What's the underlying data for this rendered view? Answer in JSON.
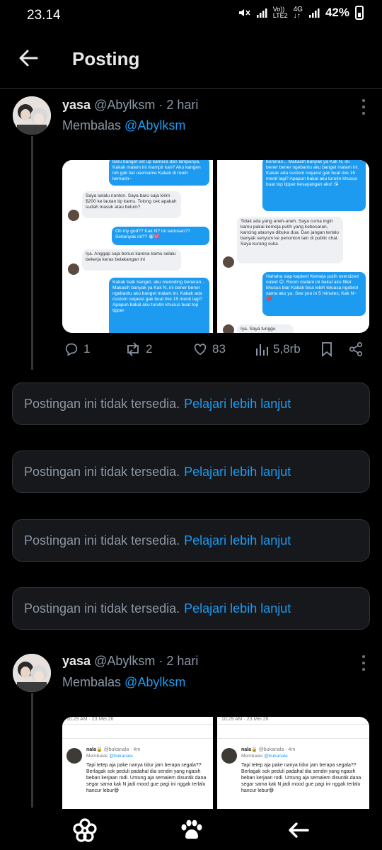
{
  "status_bar": {
    "time": "23.14",
    "network_top": "Vo))",
    "network_bottom": "LTE2",
    "data_type": "4G",
    "battery": "42%"
  },
  "header": {
    "title": "Posting"
  },
  "tweets": [
    {
      "name": "yasa",
      "handle": "@Abylksm",
      "time": "· 2 hari",
      "reply_prefix": "Membalas",
      "reply_to": "@Abylksm",
      "stats": {
        "replies": "1",
        "retweets": "2",
        "likes": "83",
        "views": "5,8rb"
      },
      "chat_left": [
        {
          "side": "out",
          "text": "baru banget set up kamera dan lampunya. Kakak malam ini mampir kan? Aku kangen loh gak liat username Kakak di room kemarin~"
        },
        {
          "side": "in",
          "text": "Saya selalu nonton. Saya baru saja kirim $200 ke lautan tip kamu. Tolong cek apakah sudah masuk atau belum?"
        },
        {
          "side": "out",
          "text": "Oh my god?? Kak N? Ini seriusan?? Sebanyak ini?? 😭💖"
        },
        {
          "side": "in",
          "text": "Iya. Anggap saja bonus karena kamu selalu bekerja keras belakangan ini"
        },
        {
          "side": "out",
          "text": "Kakak baik banget, aku merinding beneran... Makasih banyak ya Kak N, ini bener bener ngebantu aku banget malam ini. Kakak ada custom request gak buat live 15 menit lagi? Apapun bakal aku turutin khusus buat top tipper"
        }
      ],
      "chat_right": [
        {
          "side": "out",
          "text": "beneran... Makasih banyak ya Kak N, ini bener bener ngebantu aku banget malam ini. Kakak ada custom request gak buat live 15 menit lagi? Apapun bakal aku turutin khusus buat top tipper kesayangan aku! 😘"
        },
        {
          "side": "in",
          "text": "Tidak ada yang aneh-aneh. Saya cuma ingin kamu pakai kemeja putih yang kebesaran, kancing atasnya dibuka dua. Dan jangan terlalu banyak senyum ke penonton lain di public chat. Saya kurang suka"
        },
        {
          "side": "out",
          "text": "Hahaha siap kapten! Kemeja putih oversized noted 😉. Room malam ini bakal aku filter khusus biar Kakak bisa lebih leluasa ngobrol sama aku ya. See you in 5 minutes, Kak N~ ❤️"
        },
        {
          "side": "in",
          "text": "Iya. Saya tunggu"
        }
      ]
    },
    {
      "name": "yasa",
      "handle": "@Abylksm",
      "time": "· 2 hari",
      "reply_prefix": "Membalas",
      "reply_to": "@Abylksm",
      "embedded": {
        "timestamp": "10:29 AM · 23 Mei 26",
        "author": "nala🔒",
        "author_handle": "@bukanala · 4m",
        "reply_prefix": "Membalas",
        "reply_to": "@bukanala",
        "body": "Tapi tetep aja pake nanya tidur jam berapa segala?? Berlagak sok peduli padahal dia sendiri yang ngasih beban kerjaan rodi. Untung aja semalem disuntik dana segar sama kak N jadi mood gue pagi ini nggak terlalu hancur lebur😅"
      }
    }
  ],
  "unavailable_notice": {
    "text": "Postingan ini tidak tersedia.",
    "link": "Pelajari lebih lanjut"
  },
  "icons": {
    "back": "arrow-left-icon",
    "more": "more-vertical-icon",
    "reply": "reply-icon",
    "retweet": "retweet-icon",
    "like": "heart-icon",
    "views": "views-icon",
    "bookmark": "bookmark-icon",
    "share": "share-icon",
    "nav_home": "flower-icon",
    "nav_paw": "paw-icon",
    "nav_back": "nav-back-icon"
  },
  "colors": {
    "background": "#000000",
    "accent": "#1d9bf0",
    "muted": "#8b98a5",
    "card": "#16181c"
  }
}
